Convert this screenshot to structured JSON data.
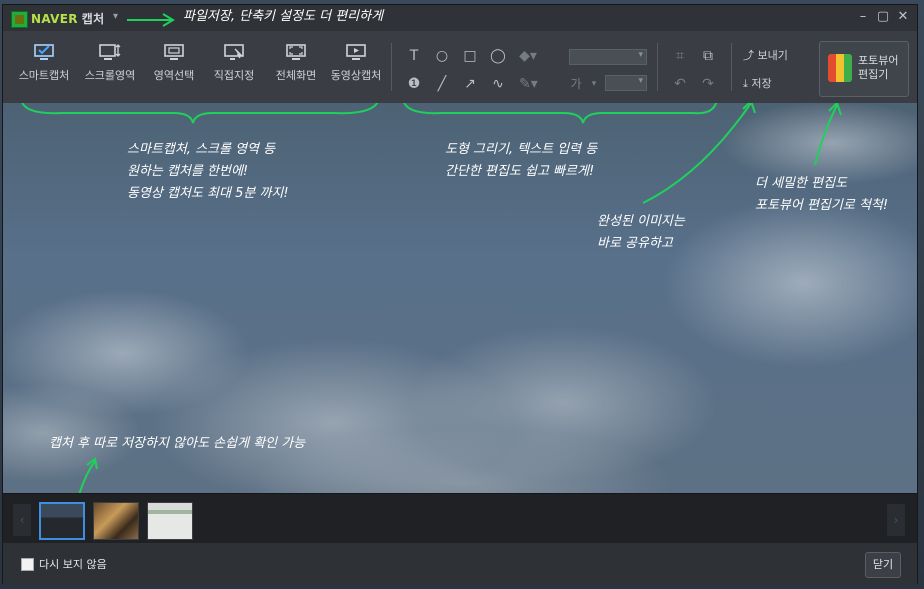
{
  "window": {
    "brand": "NAVER",
    "brand_sub": "캡처",
    "title_note": "파일저장, 단축키 설정도 더 편리하게"
  },
  "toolbar": {
    "capture_modes": [
      {
        "label": "스마트캡처",
        "icon": "smart-capture-icon"
      },
      {
        "label": "스크롤영역",
        "icon": "scroll-area-icon"
      },
      {
        "label": "영역선택",
        "icon": "area-select-icon"
      },
      {
        "label": "직접지정",
        "icon": "direct-select-icon"
      },
      {
        "label": "전체화면",
        "icon": "fullscreen-icon"
      },
      {
        "label": "동영상캡처",
        "icon": "video-capture-icon"
      }
    ],
    "draw_tools_row1": [
      "T",
      "○",
      "□",
      "◯"
    ],
    "draw_tools_row2": [
      "❶",
      "╱",
      "↗",
      "∿"
    ],
    "font_label": "가",
    "send_label": "보내기",
    "save_label": "저장",
    "photo_viewer_label_line1": "포토뷰어",
    "photo_viewer_label_line2": "편집기"
  },
  "annotations": {
    "capture": [
      "스마트캡처, 스크롤 영역 등",
      "원하는 캡처를 한번에!",
      "동영상 캡처도 최대 5분 까지!"
    ],
    "edit": [
      "도형 그리기, 텍스트 입력 등",
      "간단한 편집도 쉽고 빠르게!"
    ],
    "share": [
      "완성된 이미지는",
      "바로 공유하고"
    ],
    "photo": [
      "더 세밀한 편집도",
      "포토뷰어 편집기로 척척!"
    ],
    "history": "캡처 후 따로 저장하지 않아도 손쉽게 확인 가능"
  },
  "thumbnails": [
    {
      "time": "",
      "selected": true
    },
    {
      "time": "",
      "selected": false
    },
    {
      "time": "",
      "selected": false
    }
  ],
  "bottom": {
    "dont_show_label": "다시 보지 않음",
    "close_label": "닫기"
  },
  "colors": {
    "accent_green": "#1fd15a",
    "brand_green": "#b8e04a",
    "selected_blue": "#3f8fe0"
  }
}
